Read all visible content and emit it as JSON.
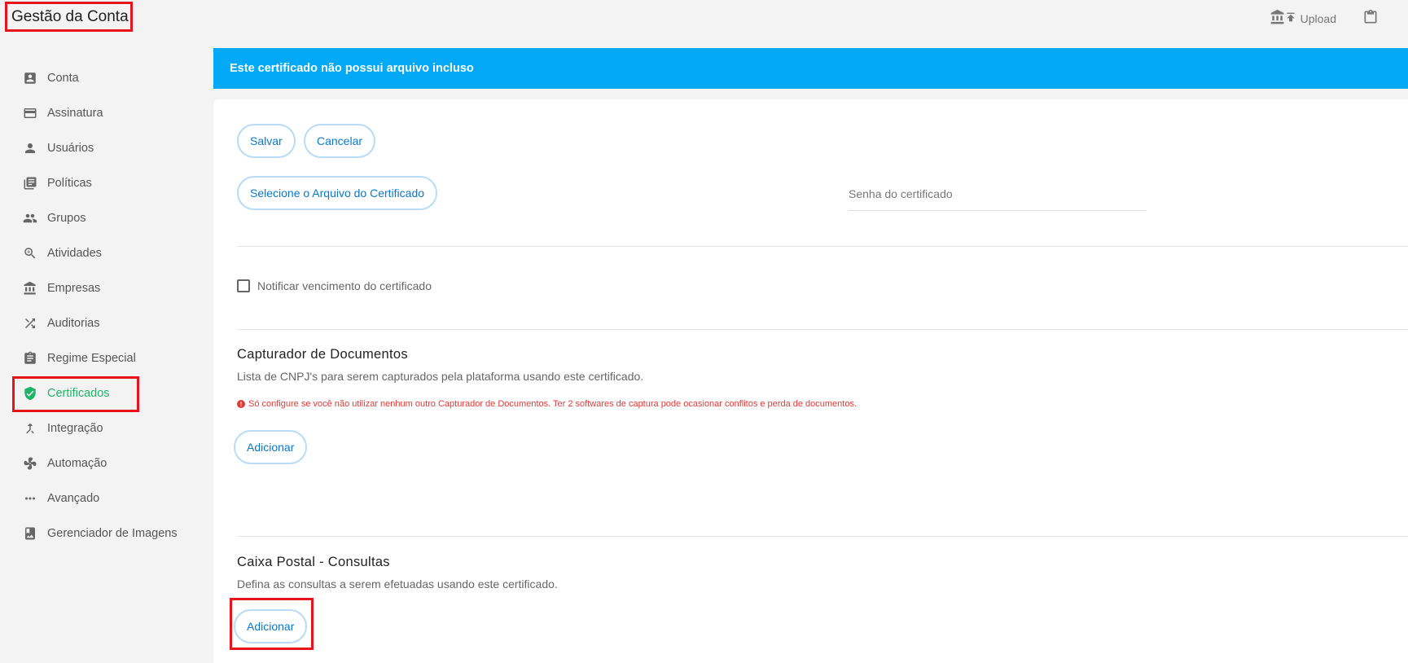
{
  "app": {
    "title": "Gestão da Conta"
  },
  "topbar": {
    "bank_icon": "bank-icon",
    "upload_label": "Upload",
    "clipboard_icon": "clipboard-icon"
  },
  "sidebar": {
    "items": [
      {
        "label": "Conta",
        "icon": "account-box-icon"
      },
      {
        "label": "Assinatura",
        "icon": "credit-card-icon"
      },
      {
        "label": "Usuários",
        "icon": "person-icon"
      },
      {
        "label": "Políticas",
        "icon": "library-books-icon"
      },
      {
        "label": "Grupos",
        "icon": "group-icon"
      },
      {
        "label": "Atividades",
        "icon": "search-zoom-icon"
      },
      {
        "label": "Empresas",
        "icon": "bank-icon"
      },
      {
        "label": "Auditorias",
        "icon": "shuffle-icon"
      },
      {
        "label": "Regime Especial",
        "icon": "assignment-icon"
      },
      {
        "label": "Certificados",
        "icon": "verified-shield-icon",
        "active": true
      },
      {
        "label": "Integração",
        "icon": "merge-icon"
      },
      {
        "label": "Automação",
        "icon": "fan-icon"
      },
      {
        "label": "Avançado",
        "icon": "more-horiz-icon"
      },
      {
        "label": "Gerenciador de Imagens",
        "icon": "photo-album-icon"
      }
    ]
  },
  "banner": {
    "text": "Este certificado não possui arquivo incluso"
  },
  "form": {
    "save_label": "Salvar",
    "cancel_label": "Cancelar",
    "select_file_label": "Selecione o Arquivo do Certificado",
    "password_placeholder": "Senha do certificado",
    "password_value": "",
    "notify_label": "Notificar vencimento do certificado",
    "notify_checked": false
  },
  "capturador": {
    "title": "Capturador de Documentos",
    "description": "Lista de CNPJ's para serem capturados pela plataforma usando este certificado.",
    "warning": "Só configure se você não utilizar nenhum outro Capturador de Documentos. Ter 2 softwares de captura pode ocasionar conflitos e perda de documentos.",
    "add_label": "Adicionar"
  },
  "caixa_postal": {
    "title": "Caixa Postal - Consultas",
    "description": "Defina as consultas a serem efetuadas usando este certificado.",
    "add_label": "Adicionar"
  },
  "colors": {
    "accent": "#03a9f4",
    "active": "#1fb36a",
    "button_text": "#0a78c8",
    "warning": "#e53935",
    "highlight": "#e8141b"
  }
}
